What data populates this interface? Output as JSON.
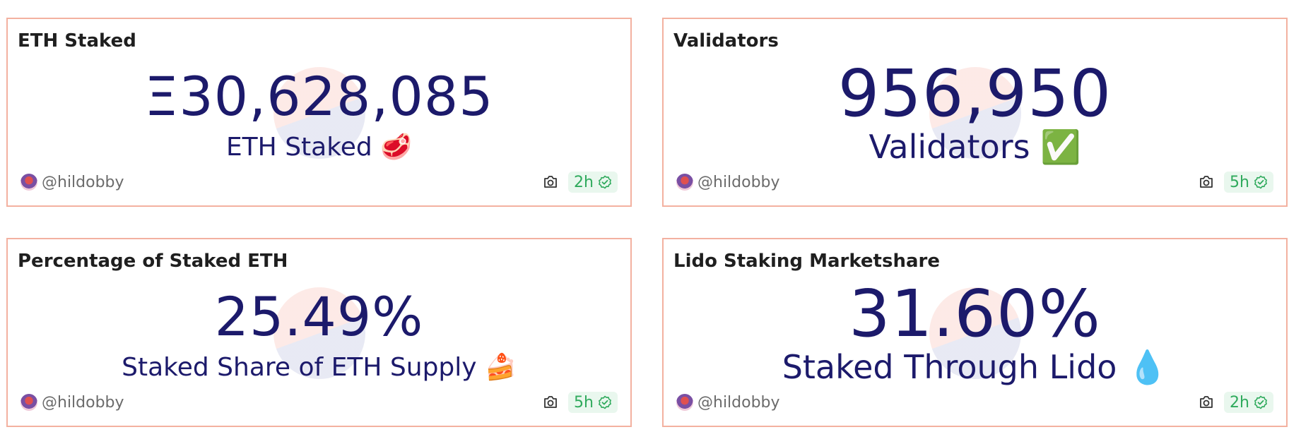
{
  "cards": [
    {
      "title": "ETH Staked",
      "value": "Ξ30,628,085",
      "label": "ETH Staked 🥩",
      "author": "@hildobby",
      "freshness": "2h"
    },
    {
      "title": "Validators",
      "value": "956,950",
      "label": "Validators ✅",
      "author": "@hildobby",
      "freshness": "5h"
    },
    {
      "title": "Percentage of Staked ETH",
      "value": "25.49%",
      "label": "Staked Share of ETH Supply 🍰",
      "author": "@hildobby",
      "freshness": "5h"
    },
    {
      "title": "Lido Staking Marketshare",
      "value": "31.60%",
      "label": "Staked Through Lido 💧",
      "author": "@hildobby",
      "freshness": "2h"
    }
  ],
  "colors": {
    "border": "#f3b1a0",
    "value_text": "#1c1a6b",
    "badge_text": "#2faa5c",
    "badge_bg": "#e9f7ee"
  },
  "icons": {
    "snapshot": "camera-icon",
    "freshness": "check-circle-icon",
    "author": "avatar"
  }
}
